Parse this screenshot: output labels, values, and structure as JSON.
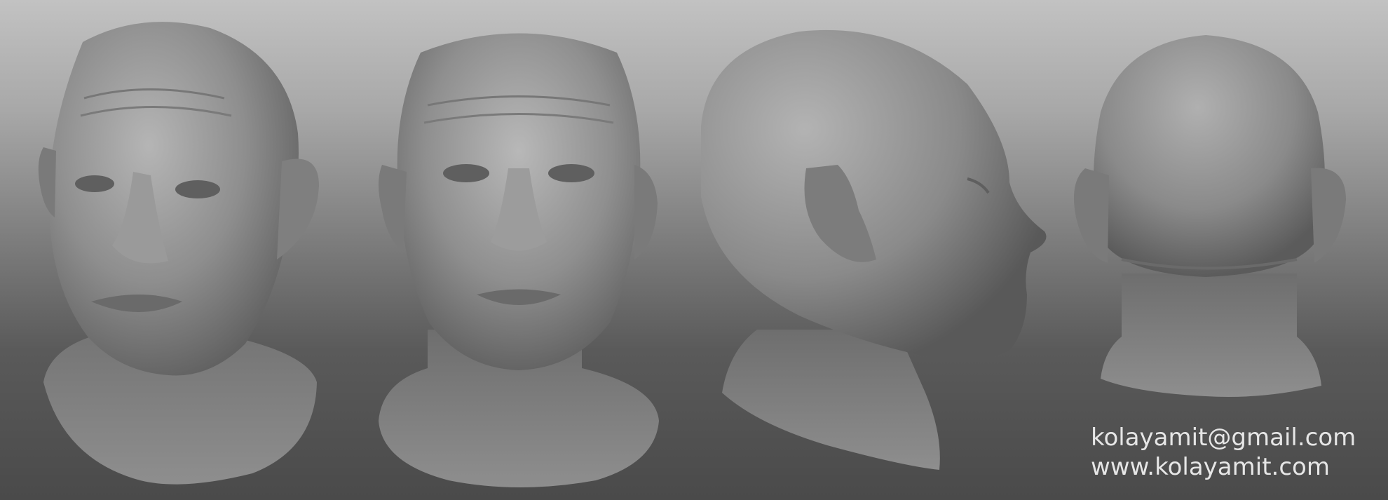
{
  "contact": {
    "email": "kolayamit@gmail.com",
    "website": "www.kolayamit.com"
  },
  "image": {
    "subject": "sculpted-head-turnaround",
    "views": [
      "three-quarter-front",
      "front",
      "side-profile",
      "back"
    ],
    "material_color": "#8c8c8c",
    "background_top": "#c2c2c2",
    "background_bottom": "#4a4a4a",
    "text_color": "#e6e6e6"
  }
}
